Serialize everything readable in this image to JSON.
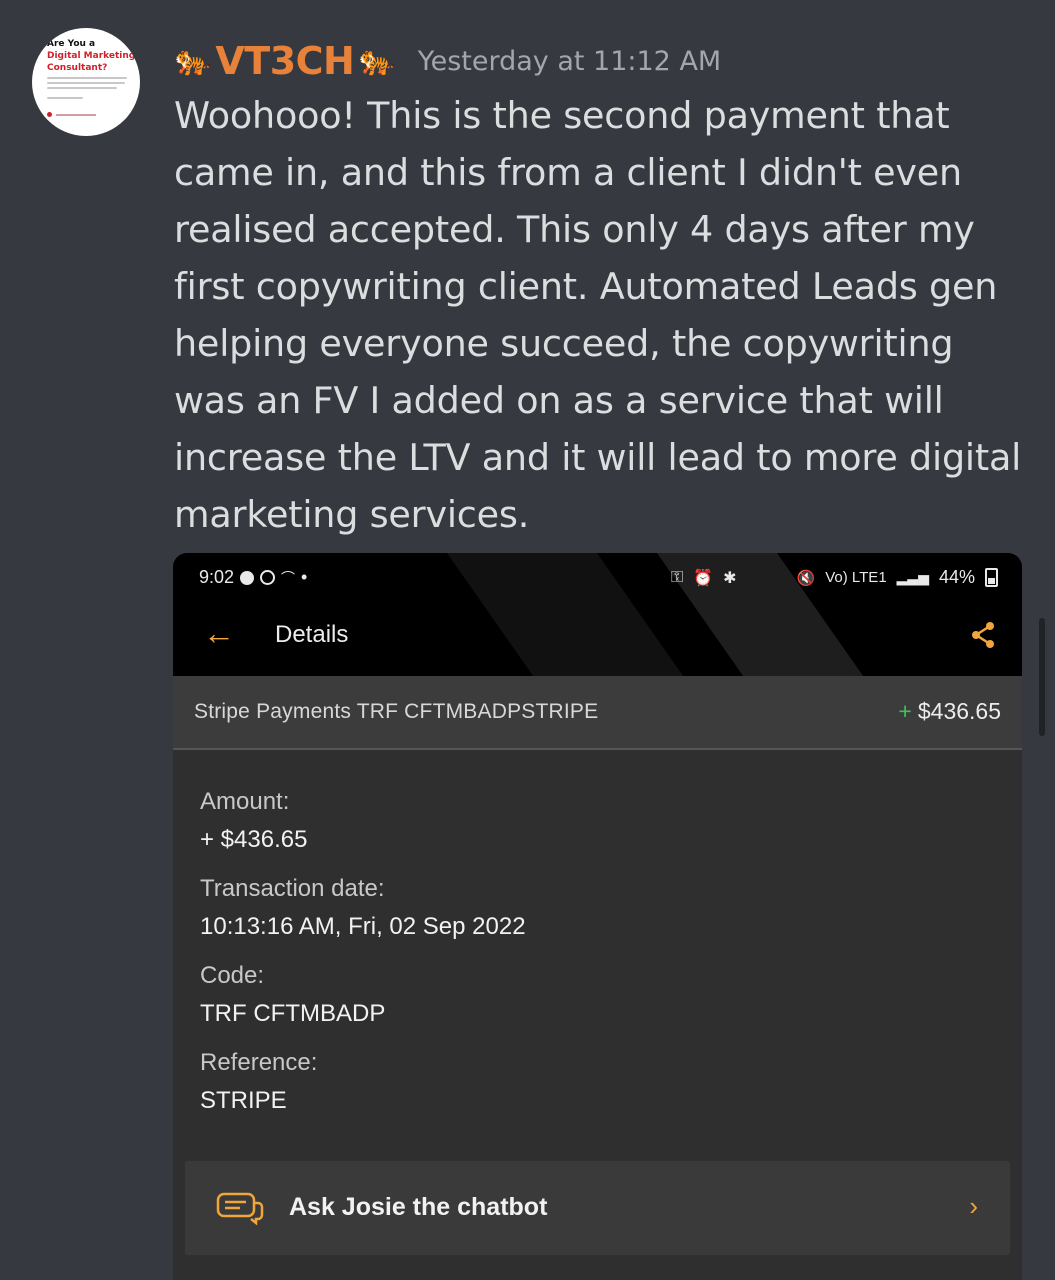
{
  "avatar": {
    "line1": "Are You a",
    "line2": "Digital Marketing Consultant?"
  },
  "message": {
    "username": "VT3CH",
    "tiger_emoji": "🐅",
    "timestamp": "Yesterday at 11:12 AM",
    "text": "Woohooo! This is the second payment that came in, and this from a client I didn't even realised accepted. This only 4 days after my first copywriting client. Automated Leads gen helping everyone succeed, the copywriting was an FV I added on as a service that will increase the LTV and it will lead to more digital marketing services."
  },
  "attachment": {
    "status_bar": {
      "time": "9:02",
      "battery": "44%",
      "network": "Vo) LTE1"
    },
    "header": {
      "title": "Details"
    },
    "transaction": {
      "name": "Stripe Payments TRF CFTMBADPSTRIPE",
      "amount": "$436.65",
      "sign": "+"
    },
    "fields": [
      {
        "label": "Amount:",
        "value": "+ $436.65"
      },
      {
        "label": "Transaction date:",
        "value": "10:13:16 AM, Fri, 02 Sep 2022"
      },
      {
        "label": "Code:",
        "value": "TRF CFTMBADP"
      },
      {
        "label": "Reference:",
        "value": "STRIPE"
      }
    ],
    "chatbot": {
      "label": "Ask Josie the chatbot"
    }
  },
  "colors": {
    "background": "#36393f",
    "username": "#e8813a",
    "accent": "#f0a63a",
    "positive": "#3ec15a"
  }
}
